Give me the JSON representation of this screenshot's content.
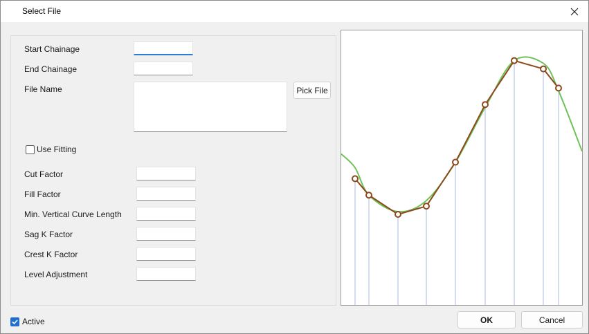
{
  "window": {
    "title": "Select File"
  },
  "form": {
    "start_chainage_label": "Start Chainage",
    "end_chainage_label": "End Chainage",
    "file_name_label": "File Name",
    "pick_file_label": "Pick File",
    "use_fitting_label": "Use Fitting",
    "use_fitting_checked": false,
    "cut_factor_label": "Cut Factor",
    "fill_factor_label": "Fill Factor",
    "min_vcl_label": "Min. Vertical Curve Length",
    "sag_k_label": "Sag K Factor",
    "crest_k_label": "Crest K Factor",
    "level_adjustment_label": "Level Adjustment",
    "start_chainage_value": "",
    "end_chainage_value": "",
    "file_name_value": "",
    "cut_factor_value": "",
    "fill_factor_value": "",
    "min_vcl_value": "",
    "sag_k_value": "",
    "crest_k_value": "",
    "level_adjustment_value": ""
  },
  "footer": {
    "active_label": "Active",
    "active_checked": true,
    "ok_label": "OK",
    "cancel_label": "Cancel"
  },
  "colors": {
    "accent": "#1f6fd1",
    "profile_line": "#8b4a1c",
    "fit_curve": "#6fc15a",
    "stations": "#d5dcef"
  },
  "chart_data": {
    "type": "line",
    "title": "",
    "xlabel": "",
    "ylabel": "",
    "x": [
      1,
      2,
      3,
      4,
      5,
      6,
      7,
      8,
      9
    ],
    "series": [
      {
        "values": [
          0.46,
          0.4,
          0.33,
          0.36,
          0.52,
          0.73,
          0.89,
          0.86,
          0.79
        ]
      },
      {
        "values": [
          0.5,
          0.4,
          0.34,
          0.38,
          0.52,
          0.72,
          0.89,
          0.88,
          0.78
        ]
      }
    ],
    "ylim": [
      0,
      1
    ],
    "grid": false
  }
}
